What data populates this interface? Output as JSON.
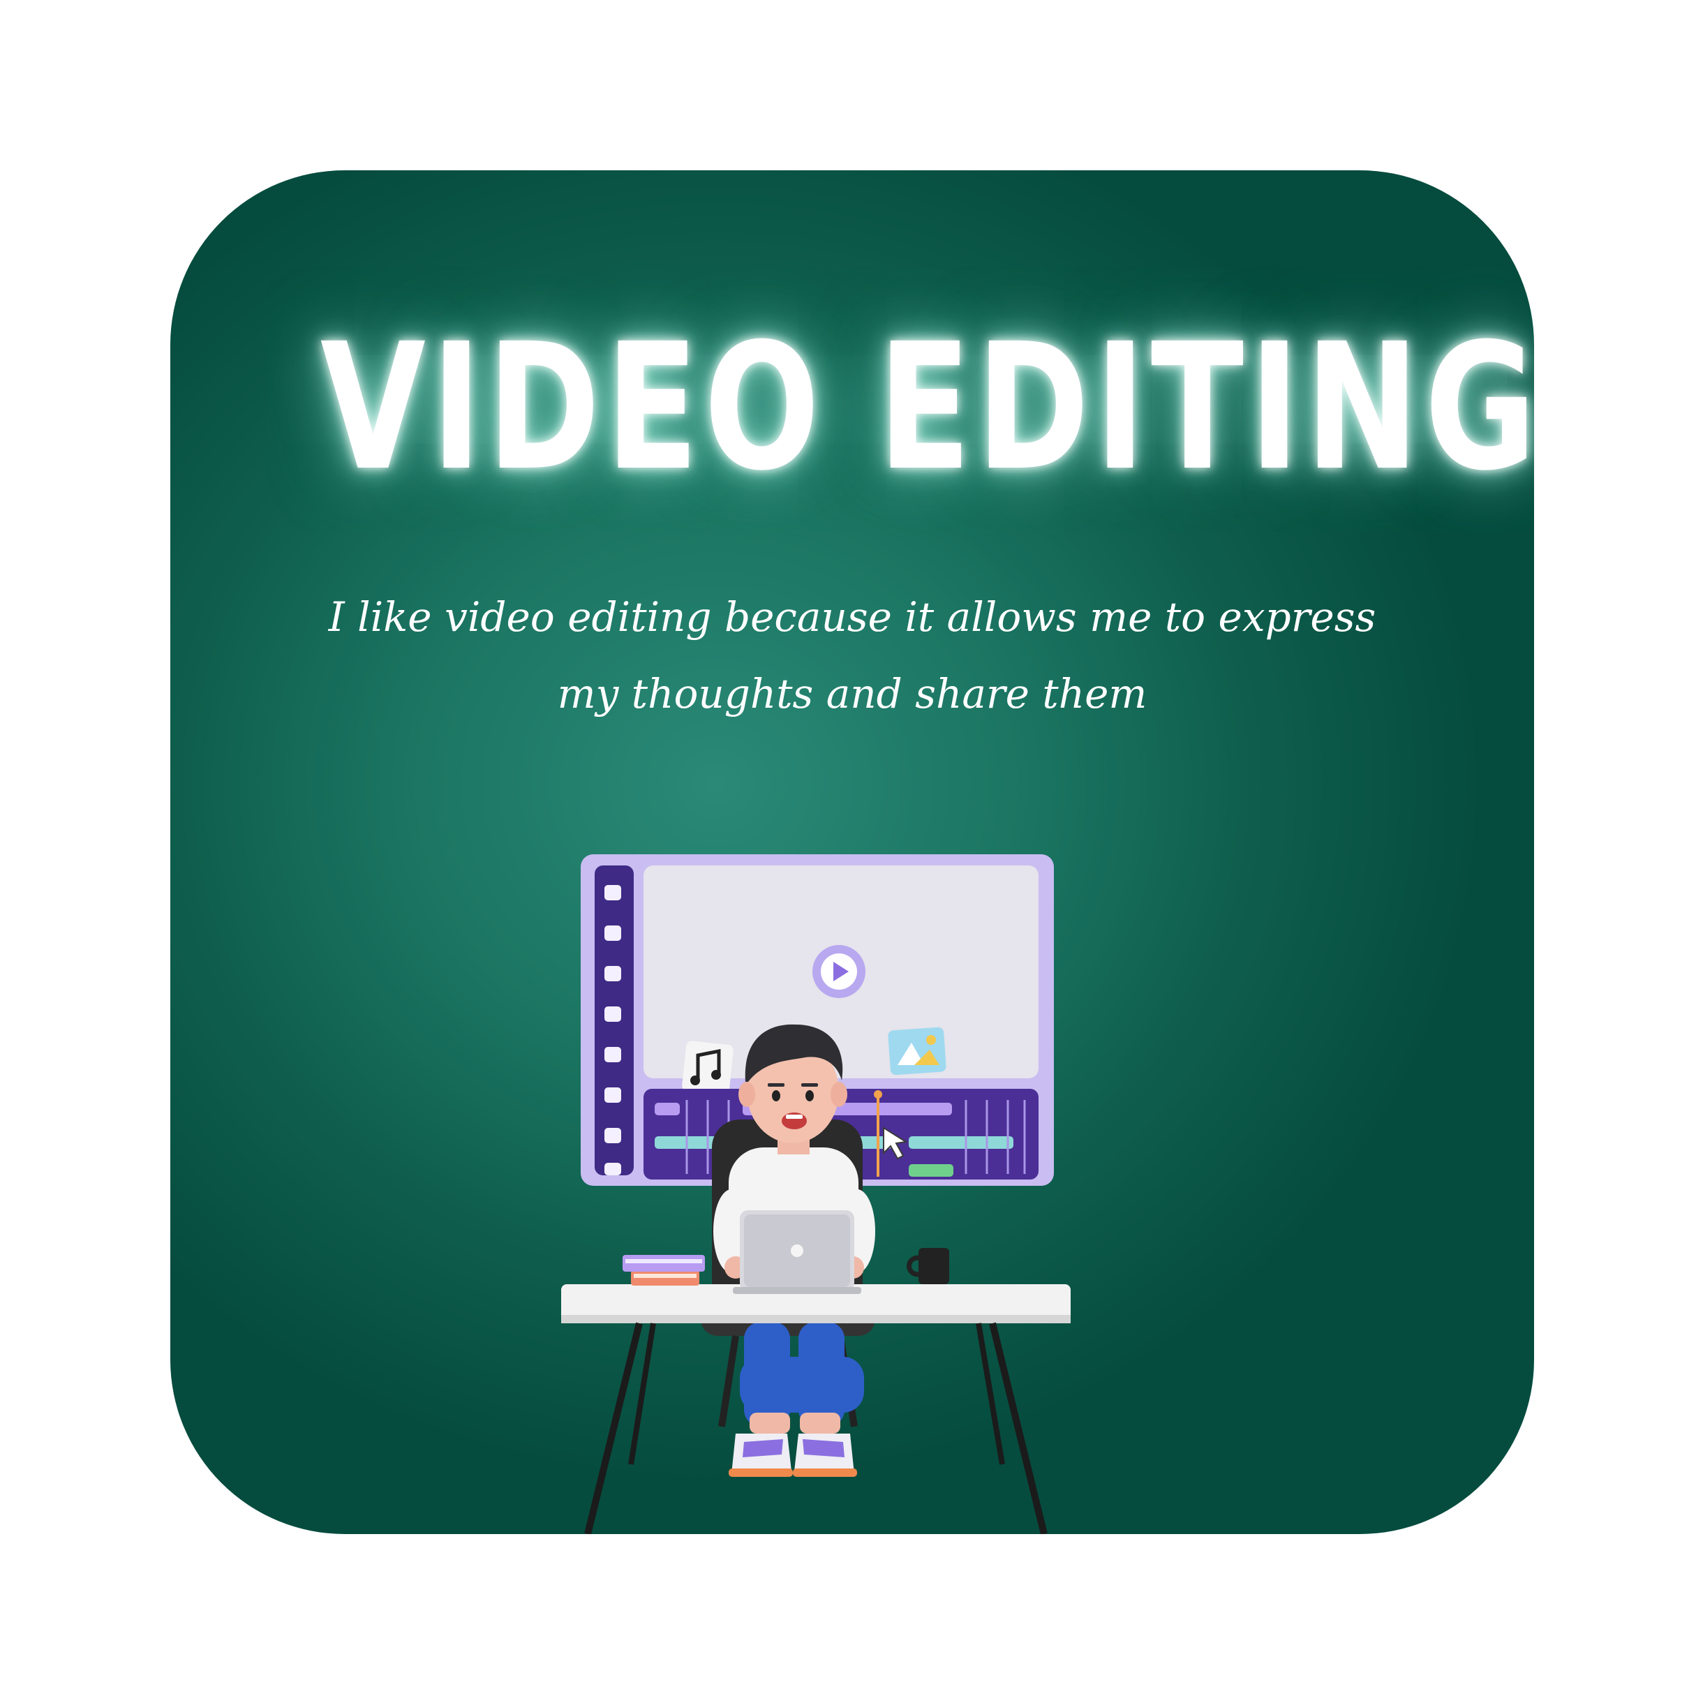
{
  "title": "VIDEO EDITING",
  "description": {
    "line1": "I like video editing because it allows me to express",
    "line2": "my thoughts and share them"
  },
  "colors": {
    "page_background": "#ffffff",
    "card_green": "#1b7562",
    "card_green_dark": "#054c3e",
    "title_glow": "#c8fff0",
    "monitor_purple": "#c8bcf0",
    "timeline_purple": "#4b2f96",
    "desk_white": "#f2f2f2",
    "jeans_blue": "#2e5ec8"
  },
  "icons": [
    "film-strip-icon",
    "play-button-icon",
    "music-note-icon",
    "image-icon",
    "cursor-arrow-icon"
  ]
}
